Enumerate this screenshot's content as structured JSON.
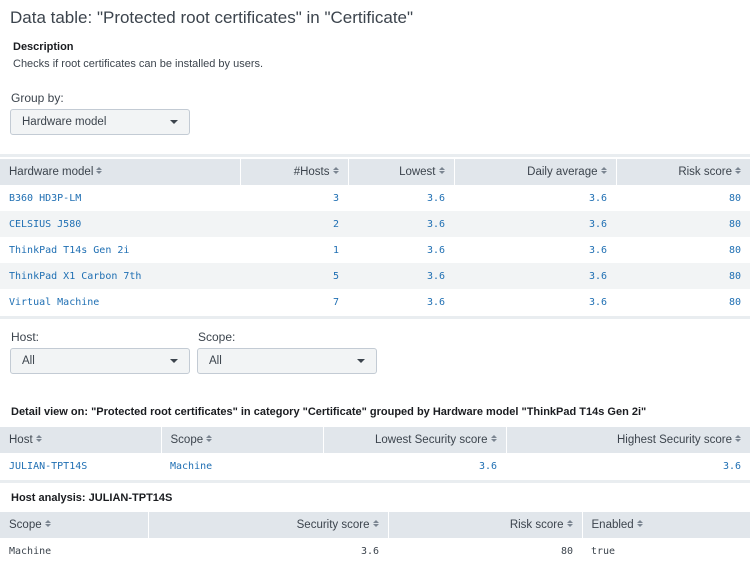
{
  "page": {
    "title": "Data table: \"Protected root certificates\" in \"Certificate\""
  },
  "description": {
    "heading": "Description",
    "text": "Checks if root certificates can be installed by users."
  },
  "group_by": {
    "label": "Group by:",
    "value": "Hardware model"
  },
  "main_table": {
    "columns": [
      "Hardware model",
      "#Hosts",
      "Lowest",
      "Daily average",
      "Risk score"
    ],
    "rows": [
      [
        "B360 HD3P-LM",
        "3",
        "3.6",
        "3.6",
        "80"
      ],
      [
        "CELSIUS J580",
        "2",
        "3.6",
        "3.6",
        "80"
      ],
      [
        "ThinkPad T14s Gen 2i",
        "1",
        "3.6",
        "3.6",
        "80"
      ],
      [
        "ThinkPad X1 Carbon 7th",
        "5",
        "3.6",
        "3.6",
        "80"
      ],
      [
        "Virtual Machine",
        "7",
        "3.6",
        "3.6",
        "80"
      ]
    ]
  },
  "filters": {
    "host": {
      "label": "Host:",
      "value": "All"
    },
    "scope": {
      "label": "Scope:",
      "value": "All"
    }
  },
  "detail": {
    "title": "Detail view on: \"Protected root certificates\" in category \"Certificate\" grouped by Hardware model \"ThinkPad T14s Gen 2i\"",
    "columns": [
      "Host",
      "Scope",
      "Lowest Security score",
      "Highest Security score"
    ],
    "rows": [
      [
        "JULIAN-TPT14S",
        "Machine",
        "3.6",
        "3.6"
      ]
    ]
  },
  "host_analysis": {
    "title": "Host analysis: JULIAN-TPT14S",
    "columns": [
      "Scope",
      "Security score",
      "Risk score",
      "Enabled"
    ],
    "rows": [
      [
        "Machine",
        "3.6",
        "80",
        "true"
      ]
    ]
  }
}
